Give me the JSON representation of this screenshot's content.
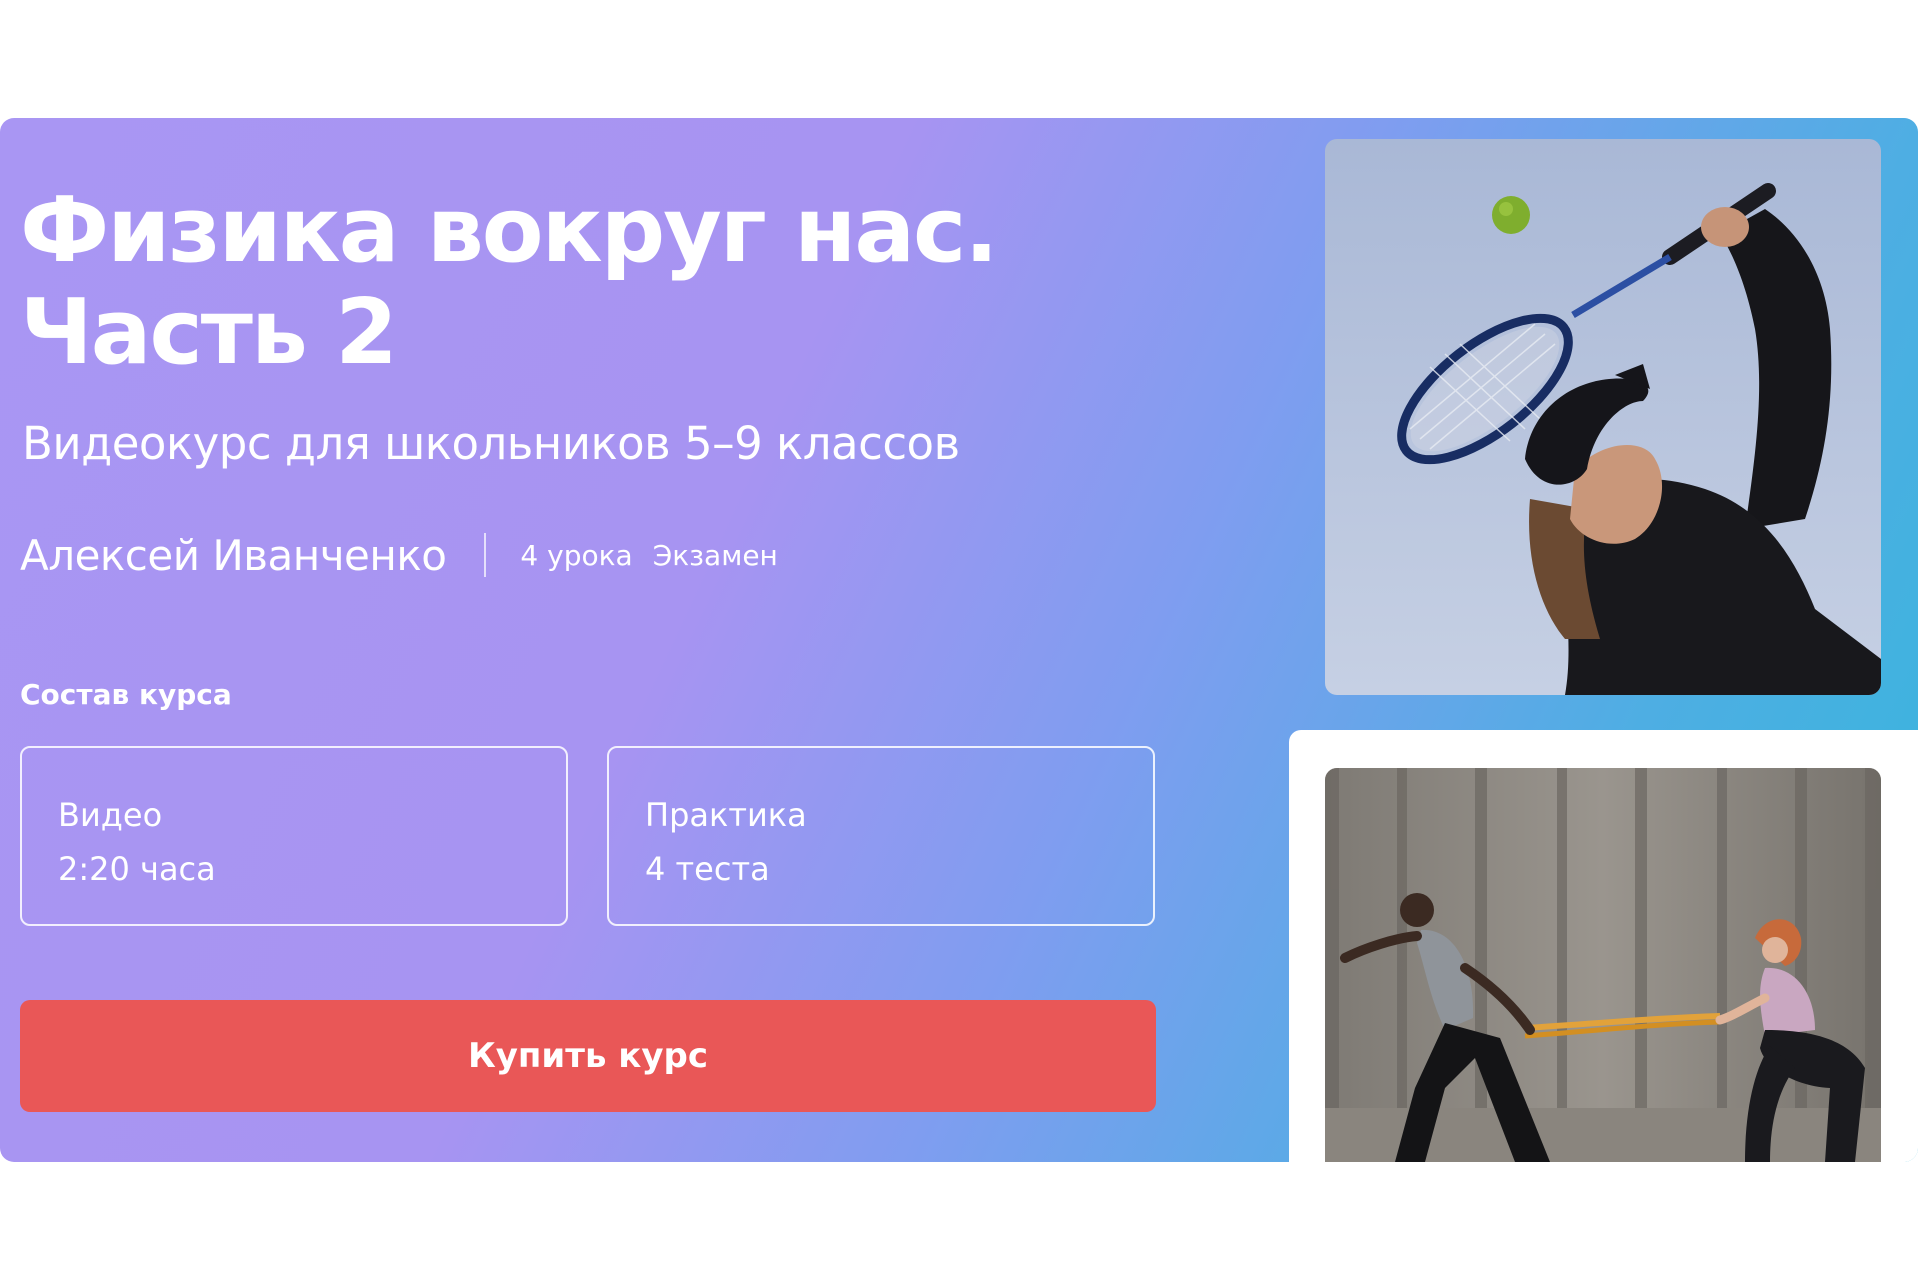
{
  "course": {
    "title_line1": "Физика вокруг нас.",
    "title_line2": "Часть 2",
    "subtitle": "Видеокурс для школьников 5–9 классов",
    "author": "Алексей Иванченко",
    "lessons": "4 урока",
    "exam": "Экзамен"
  },
  "composition": {
    "label": "Состав курса",
    "cards": [
      {
        "title": "Видео",
        "value": "2:20 часа"
      },
      {
        "title": "Практика",
        "value": "4 теста"
      }
    ]
  },
  "actions": {
    "buy_label": "Купить курс"
  },
  "colors": {
    "gradient_start": "#a996f3",
    "gradient_end": "#35b6dc",
    "button": "#e95757"
  },
  "images": [
    {
      "name": "tennis-player-photo"
    },
    {
      "name": "resistance-band-training-photo"
    }
  ]
}
